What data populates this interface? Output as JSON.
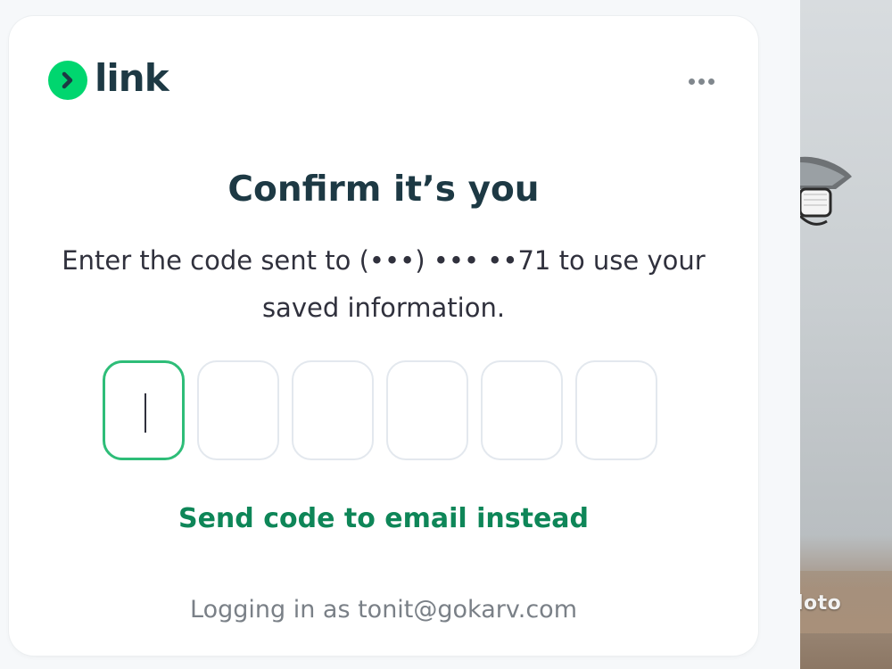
{
  "brand": {
    "name": "link",
    "accent_color": "#00d66f",
    "text_color": "#1d3944",
    "logo_icon": "chevron-right-icon"
  },
  "header": {
    "more_icon": "more-horizontal-icon"
  },
  "dialog": {
    "title": "Confirm it’s you",
    "subtitle": "Enter the code sent to (•••) ••• ••71 to use your saved information."
  },
  "code_input": {
    "length": 6,
    "active_index": 0,
    "active_border_color": "#2ebd78",
    "values": [
      "",
      "",
      "",
      "",
      "",
      ""
    ]
  },
  "actions": {
    "email_instead_label": "Send code to email instead",
    "link_color": "#0e8658"
  },
  "footer": {
    "logged_in_text": "Logging in as tonit@gokarv.com"
  },
  "background": {
    "caption": "loto"
  }
}
